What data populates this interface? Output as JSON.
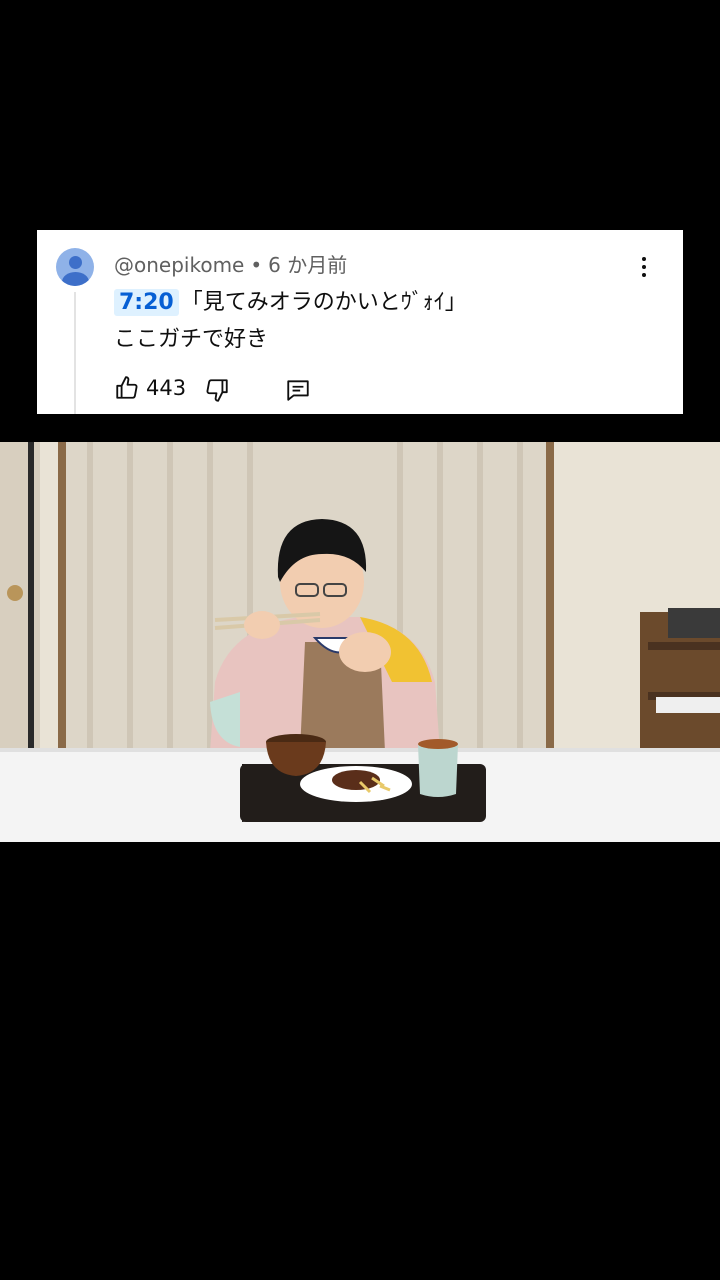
{
  "comment": {
    "author": "@onepikome",
    "separator": "•",
    "time_ago": "6 か月前",
    "timestamp_link": "7:20",
    "text_line1": "「見てみオラのかいとｳﾞｫｲ」",
    "text_line2": "ここガチで好き",
    "like_count": "443"
  },
  "icons": {
    "avatar": "default-user-avatar",
    "menu": "more-vert-icon",
    "like": "thumbs-up-icon",
    "dislike": "thumbs-down-icon",
    "reply": "comment-reply-icon"
  },
  "colors": {
    "background": "#000000",
    "card": "#ffffff",
    "timestamp_bg": "#def1ff",
    "timestamp_text": "#065fd4",
    "meta_text": "#606060"
  }
}
